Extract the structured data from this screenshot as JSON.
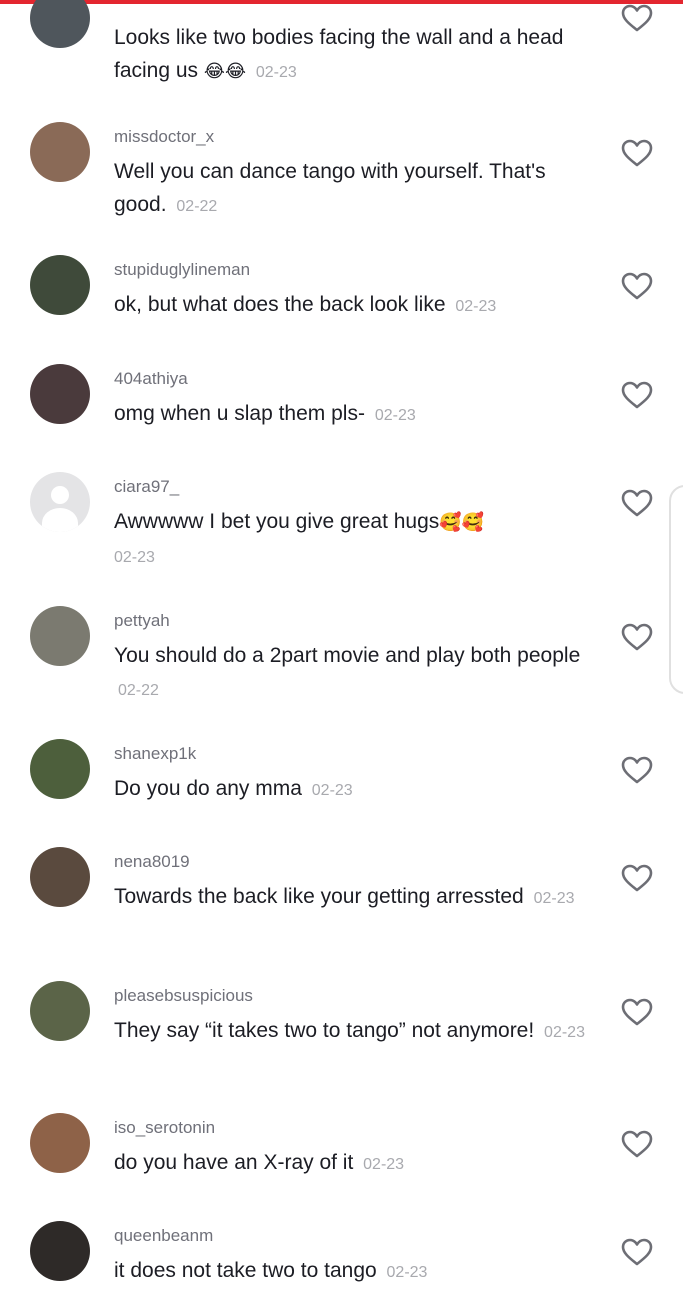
{
  "accent_color": "#e3262f",
  "comments": [
    {
      "username": "",
      "text": "Looks like two bodies facing the wall and a head facing us",
      "emoji": "😂😂",
      "date": "02-23",
      "avatar_color": "#4f565c",
      "avatar_default": false
    },
    {
      "username": "missdoctor_x",
      "text": "Well you can dance tango with yourself. That's good.",
      "emoji": "",
      "date": "02-22",
      "avatar_color": "#8a6a57",
      "avatar_default": false
    },
    {
      "username": "stupiduglylineman",
      "text": "ok, but what does the back look like",
      "emoji": "",
      "date": "02-23",
      "avatar_color": "#3f4a3a",
      "avatar_default": false
    },
    {
      "username": "404athiya",
      "text": "omg when u slap them pls-",
      "emoji": "",
      "date": "02-23",
      "avatar_color": "#4a3a3c",
      "avatar_default": false
    },
    {
      "username": "ciara97_",
      "text": "Awwwww I bet you give great hugs",
      "emoji": "🥰🥰",
      "date": "02-23",
      "avatar_color": "#e4e4e6",
      "avatar_default": true
    },
    {
      "username": "pettyah",
      "text": "You should do a 2part movie and play both people",
      "emoji": "",
      "date": "02-22",
      "avatar_color": "#7b7a70",
      "avatar_default": false
    },
    {
      "username": "shanexp1k",
      "text": "Do you do any mma",
      "emoji": "",
      "date": "02-23",
      "avatar_color": "#4d5f3c",
      "avatar_default": false
    },
    {
      "username": "nena8019",
      "text": "Towards the back like your getting arressted",
      "emoji": "",
      "date": "02-23",
      "avatar_color": "#5a4a3e",
      "avatar_default": false
    },
    {
      "username": "pleasebsuspicious",
      "text": "They say “it takes two to tango” not anymore!",
      "emoji": "",
      "date": "02-23",
      "avatar_color": "#5b6448",
      "avatar_default": false
    },
    {
      "username": "iso_serotonin",
      "text": "do you have an X-ray of it",
      "emoji": "",
      "date": "02-23",
      "avatar_color": "#8e6248",
      "avatar_default": false
    },
    {
      "username": "queenbeanm",
      "text": "it does not take two to tango",
      "emoji": "",
      "date": "02-23",
      "avatar_color": "#2e2a28",
      "avatar_default": false
    }
  ],
  "icons": {
    "like": "heart-outline-icon",
    "default_avatar": "person-icon"
  }
}
